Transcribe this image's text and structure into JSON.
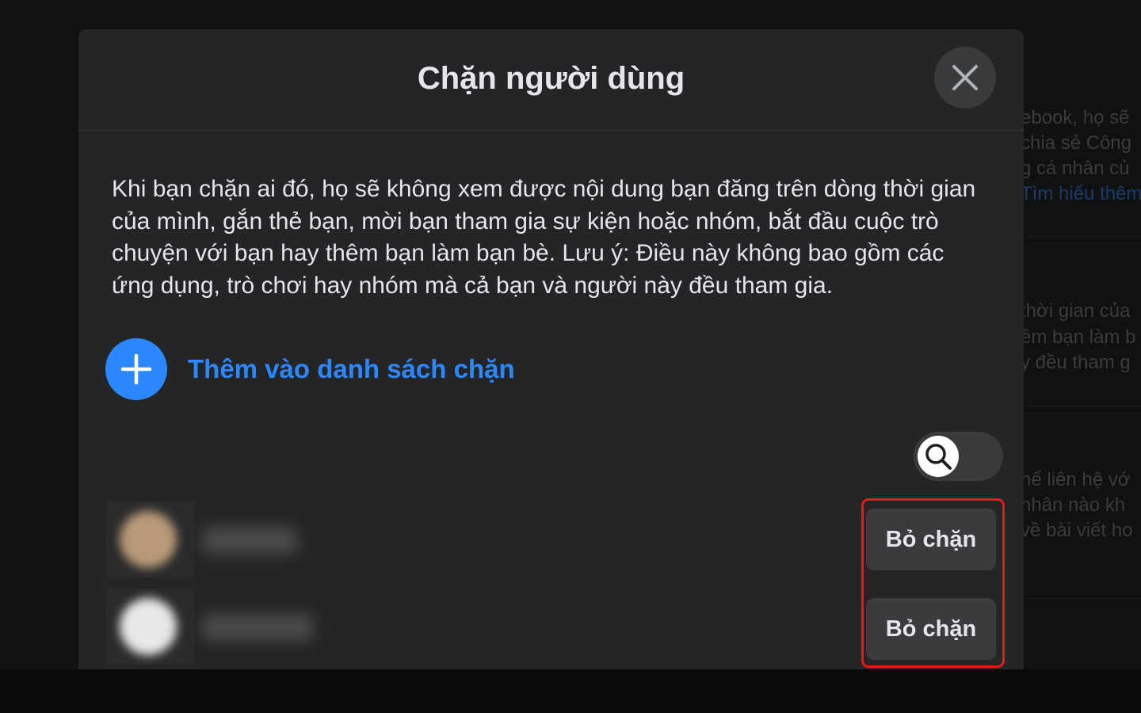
{
  "dialog": {
    "title": "Chặn người dùng",
    "description": "Khi bạn chặn ai đó, họ sẽ không xem được nội dung bạn đăng trên dòng thời gian của mình, gắn thẻ bạn, mời bạn tham gia sự kiện hoặc nhóm, bắt đầu cuộc trò chuyện với bạn hay thêm bạn làm bạn bè. Lưu ý: Điều này không bao gồm các ứng dụng, trò chơi hay nhóm mà cả bạn và người này đều tham gia.",
    "add_label": "Thêm vào danh sách chặn",
    "close_icon": "close-icon",
    "search_icon": "search-icon",
    "blocked_users": [
      {
        "unblock_label": "Bỏ chặn"
      },
      {
        "unblock_label": "Bỏ chặn"
      }
    ]
  },
  "background_page": {
    "lines_1": [
      "ebook, họ sẽ",
      "chia sẻ Công",
      "g cá nhân củ"
    ],
    "link_1": "Tìm hiểu thêm",
    "lines_2": [
      "thời gian của",
      "êm bạn làm b",
      "y đều tham g"
    ],
    "lines_3": [
      "hể liên hệ vớ",
      "nhân nào kh",
      "về bài viết ho"
    ]
  },
  "colors": {
    "accent": "#2d88ff",
    "highlight": "#e21b1b",
    "dialog_bg": "#242526",
    "button_bg": "#3a3b3c",
    "text": "#e4e6eb"
  }
}
